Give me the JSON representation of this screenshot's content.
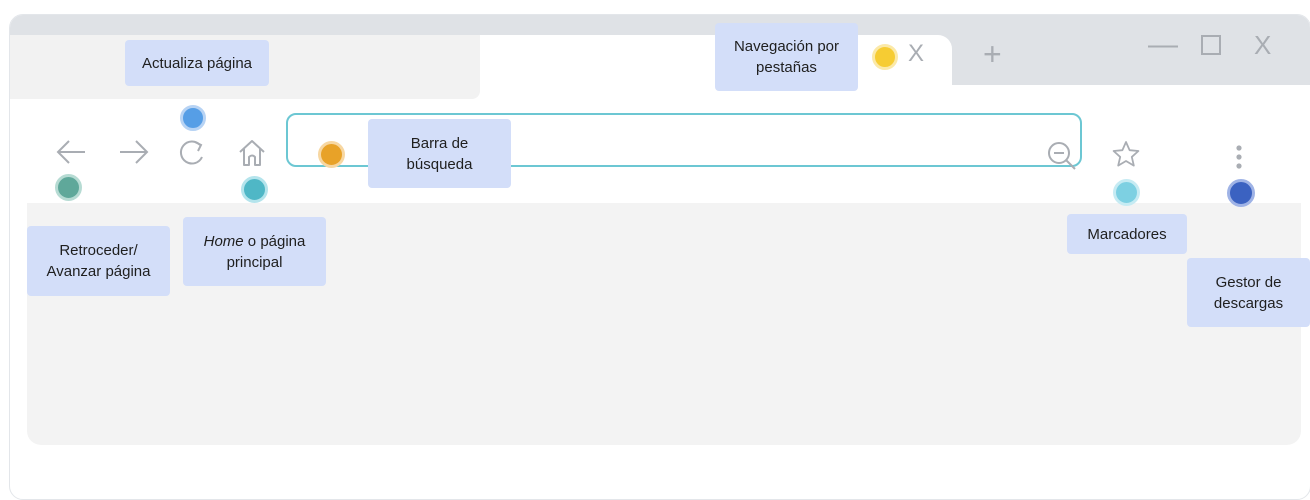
{
  "labels": {
    "tabs_nav": "Navegación por pestañas",
    "reload": "Actualiza página",
    "search_bar": "Barra de búsqueda",
    "back_forward": "Retroceder/ Avanzar página",
    "home_em": "Home",
    "home_rest": " o página principal",
    "bookmarks": "Marcadores",
    "downloads": "Gestor de descargas"
  },
  "tab": {
    "close_glyph": "X",
    "new_tab_glyph": "+"
  },
  "window_controls": {
    "minimize": "—",
    "maximize": "☐",
    "close": "X"
  },
  "colors": {
    "tabs_nav": "#f6cc33",
    "reload": "#569ee6",
    "search_bar": "#e8a228",
    "back_forward": "#5fa89a",
    "home": "#4fb7c6",
    "bookmarks": "#7dd0e2",
    "downloads": "#3b62c1"
  },
  "icons": [
    "back-arrow-icon",
    "forward-arrow-icon",
    "reload-icon",
    "home-icon",
    "search-icon",
    "star-icon",
    "menu-dots-icon"
  ]
}
